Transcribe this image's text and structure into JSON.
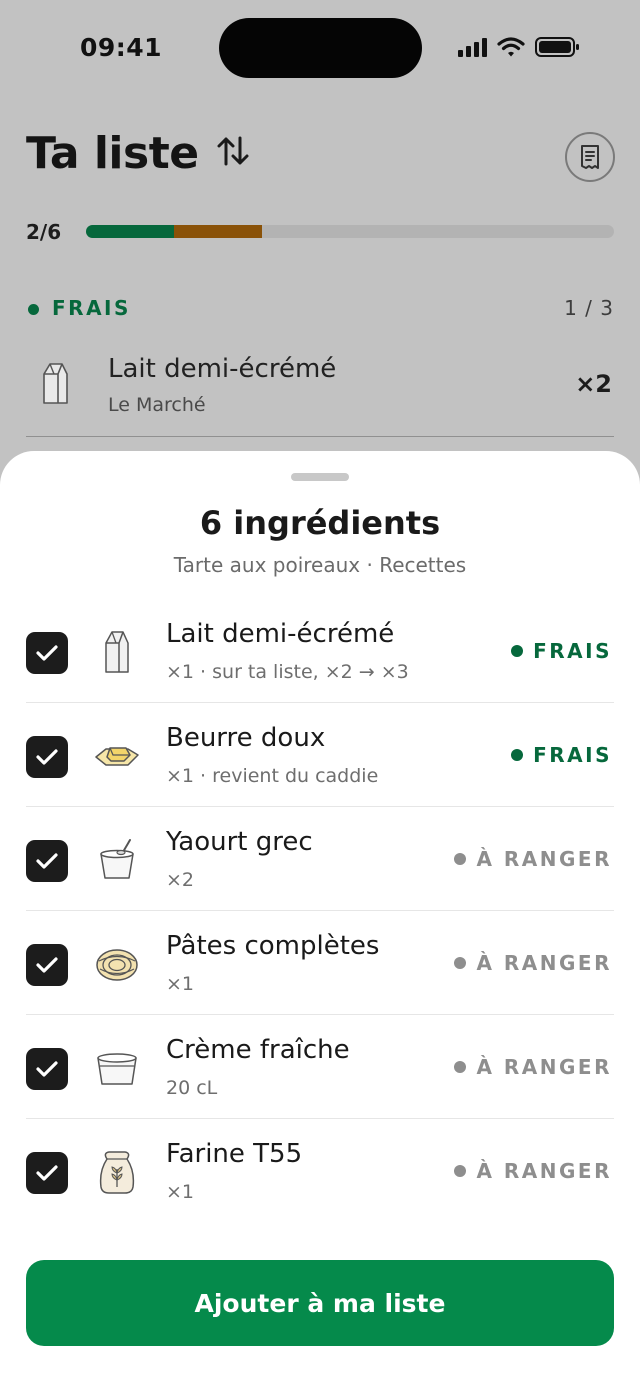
{
  "status_bar": {
    "time": "09:41"
  },
  "header": {
    "title": "Ta liste"
  },
  "progress": {
    "label": "2/6",
    "fraction": 0.333,
    "green_fraction": 0.167,
    "orange_fraction": 0.167
  },
  "section": {
    "label": "FRAIS",
    "count": "1 / 3"
  },
  "background_item": {
    "name": "Lait demi-écrémé",
    "store": "Le Marché",
    "quantity": "×2",
    "icon": "milk-carton-icon"
  },
  "sheet": {
    "title": "6 ingrédients",
    "subtitle": "Tarte aux poireaux · Recettes",
    "items": [
      {
        "name": "Lait demi-écrémé",
        "detail": "×1 · sur ta liste, ×2 → ×3",
        "tag": "FRAIS",
        "checked": true,
        "icon": "milk-carton-icon"
      },
      {
        "name": "Beurre doux",
        "detail": "×1 · revient du caddie",
        "tag": "FRAIS",
        "checked": true,
        "icon": "butter-icon"
      },
      {
        "name": "Yaourt grec",
        "detail": "×2",
        "tag": "À RANGER",
        "checked": true,
        "icon": "yogurt-icon"
      },
      {
        "name": "Pâtes complètes",
        "detail": "×1",
        "tag": "À RANGER",
        "checked": true,
        "icon": "pasta-icon"
      },
      {
        "name": "Crème fraîche",
        "detail": "20 cL",
        "tag": "À RANGER",
        "checked": true,
        "icon": "cream-tub-icon"
      },
      {
        "name": "Farine T55",
        "detail": "×1",
        "tag": "À RANGER",
        "checked": true,
        "icon": "flour-bag-icon"
      }
    ],
    "cta_label": "Ajouter à ma liste"
  },
  "colors": {
    "green": "#06683c",
    "cta": "#058a4b",
    "orange": "#8a5208",
    "grey_tag": "#8e8e8e"
  }
}
